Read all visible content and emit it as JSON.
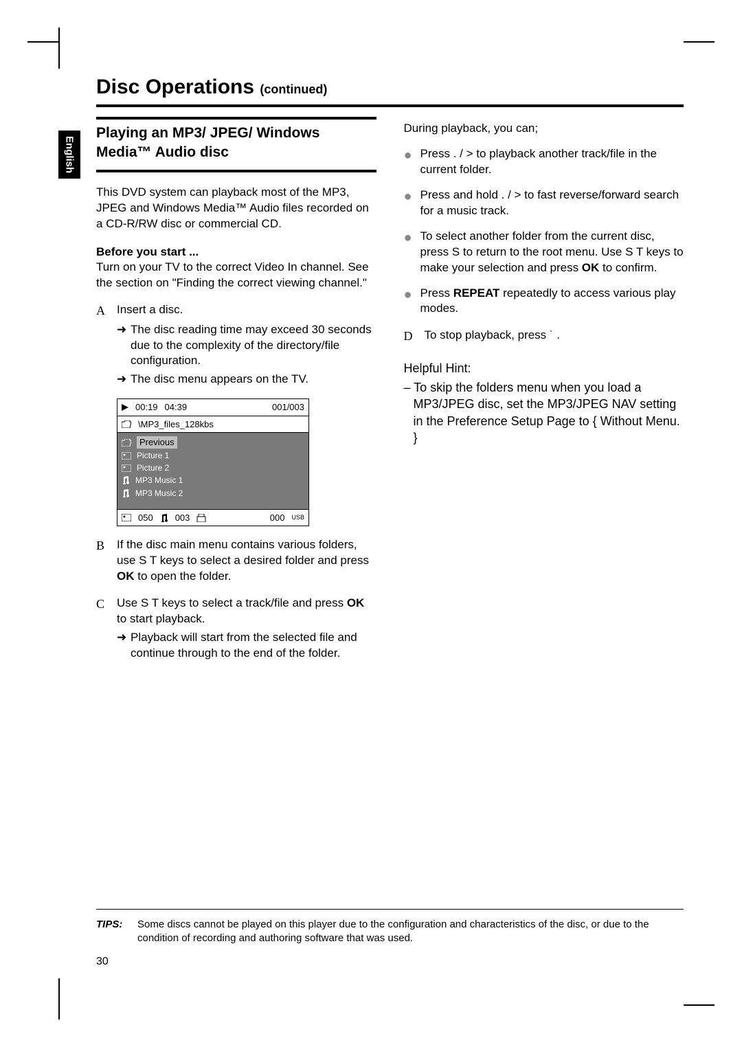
{
  "lang_tab": "English",
  "heading": {
    "main": "Disc Operations",
    "cont": "(continued)"
  },
  "subhead": "Playing an MP3/ JPEG/ Windows Media™ Audio disc",
  "intro": "This DVD system can playback most of the MP3, JPEG and Windows Media™ Audio files recorded on a CD-R/RW disc or commercial CD.",
  "before_head": "Before you start ...",
  "before_body": "Turn on your TV to the correct Video In channel.  See the section on \"Finding the correct viewing channel.\"",
  "steps": {
    "A": "Insert a disc.",
    "A_sub1": "The disc reading time may exceed 30 seconds due to the complexity of the directory/file configuration.",
    "A_sub2": "The disc menu appears on the TV.",
    "B_pre": "If the disc main menu contains various folders, use  ",
    "B_mid": "  keys to select a desired folder and press ",
    "B_ok": "OK",
    "B_post": " to open the folder.",
    "C_pre": "Use  ",
    "C_mid": "  keys to select a track/file and press ",
    "C_post": " to start playback.",
    "C_sub": "Playback will start from the selected file and continue through to the end of the folder.",
    "D": "To stop playback, press  ˙  ."
  },
  "arrows_updown": "S T",
  "during": "During playback, you can;",
  "bullets": {
    "b1_pre": "Press  .       / >       to playback another track/file in the current folder.",
    "b2": "Press and hold  .      / >       to fast reverse/forward search for a music track.",
    "b3_pre": "To select another folder from the current disc, press  ",
    "b3_s": "S",
    "b3_mid": " to return to the root menu.  Use  ",
    "b3_post": "  keys to make your selection and press ",
    "b3_end": " to confirm.",
    "b4_pre": "Press ",
    "b4_word": "REPEAT",
    "b4_post": " repeatedly to access various play modes."
  },
  "hint": {
    "head": "Helpful Hint:",
    "body": "– To skip the folders menu when you load a MP3/JPEG disc, set the MP3/JPEG NAV setting in the Preference Setup Page to   { Without Menu. }"
  },
  "osd": {
    "time1": "00:19",
    "time2": "04:39",
    "track": "001/003",
    "path": "\\MP3_files_128kbs",
    "items": [
      "Previous",
      "Picture 1",
      "Picture 2",
      "MP3 Music 1",
      "MP3 Music 2"
    ],
    "footer": {
      "a": "050",
      "b": "003",
      "c": "000",
      "usb": "USB"
    }
  },
  "tips": {
    "label": "TIPS:",
    "text": "Some discs cannot be played on this player due to the configuration and characteristics of the disc, or due to the condition of recording and authoring software that was used."
  },
  "page_number": "30"
}
